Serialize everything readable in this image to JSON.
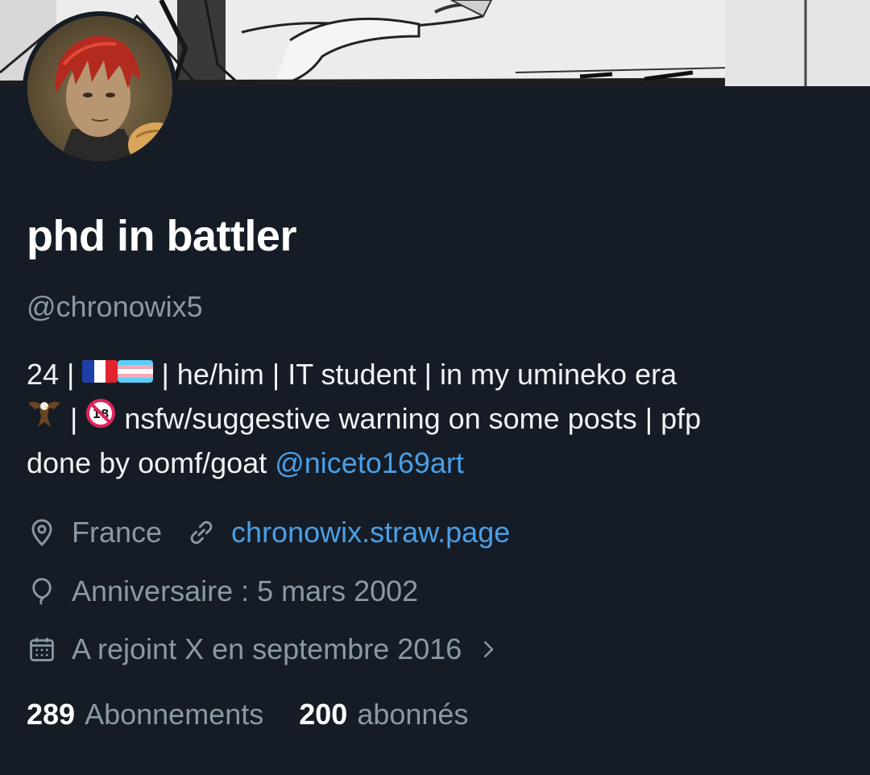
{
  "profile": {
    "display_name": "phd in battler",
    "handle": "@chronowix5",
    "bio": {
      "line1_a": "24 |",
      "line1_b": "| he/him | IT student | in my umineko era",
      "line2_a": "|",
      "line2_b": "nsfw/suggestive warning on some posts | pfp",
      "line3_a": "done by oomf/goat",
      "mention": "@niceto169art"
    },
    "emojis": [
      "flag-france",
      "flag-transgender",
      "eagle",
      "no-under-18"
    ],
    "location": "France",
    "website": "chronowix.straw.page",
    "birthday": "Anniversaire : 5 mars 2002",
    "joined": "A rejoint X en septembre 2016"
  },
  "stats": {
    "following_count": "289",
    "following_label": "Abonnements",
    "followers_count": "200",
    "followers_label": "abonnés"
  },
  "icons": [
    "location-pin-icon",
    "link-icon",
    "balloon-icon",
    "calendar-icon",
    "chevron-right-icon"
  ],
  "colors": {
    "background": "#151c26",
    "accent_link": "#4a9fe6",
    "secondary_text": "#8b98a5",
    "primary_text": "#ffffff"
  }
}
